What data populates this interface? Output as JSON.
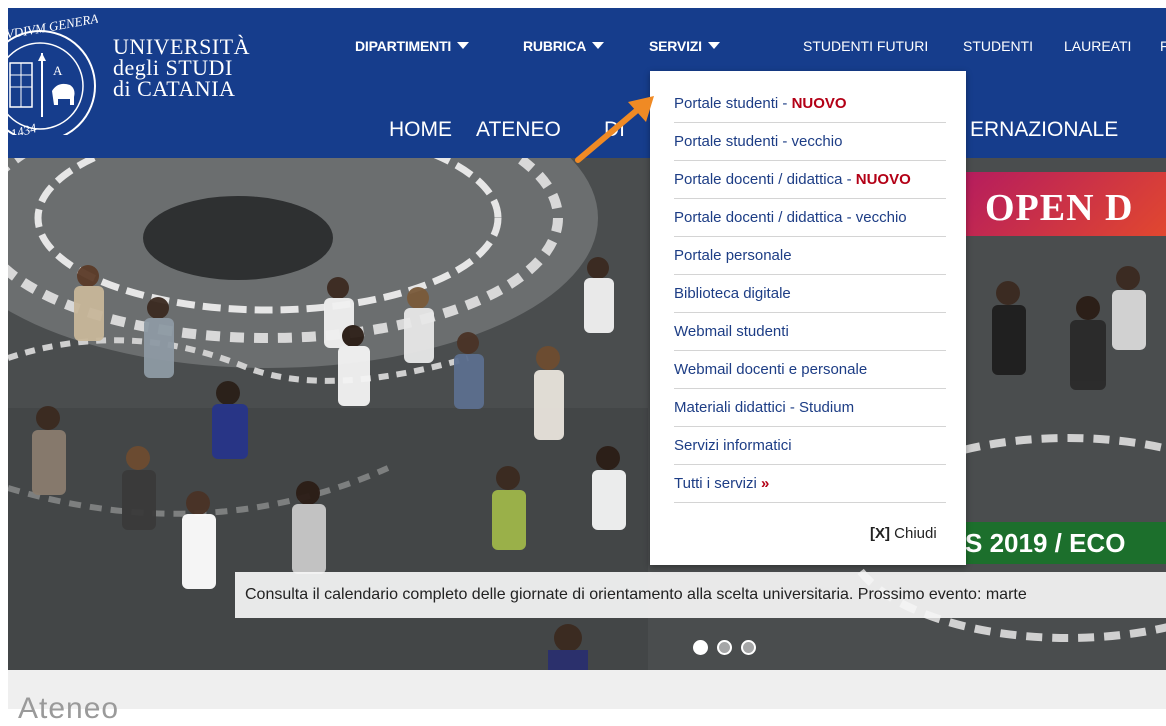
{
  "header": {
    "university_name": [
      "UNIVERSITÀ",
      "degli STUDI",
      "di CATANIA"
    ],
    "seal_text": [
      "VDIVM GENERALE",
      "1434"
    ],
    "top_nav": {
      "dipartimenti": "DIPARTIMENTI",
      "rubrica": "RUBRICA",
      "servizi": "SERVIZI",
      "studenti_futuri": "STUDENTI FUTURI",
      "studenti": "STUDENTI",
      "laureati": "LAUREATI",
      "cut_off": "F"
    },
    "main_nav": {
      "home": "HOME",
      "ateneo": "ATENEO",
      "partial_left": "DI",
      "internazionale": "ERNAZIONALE"
    }
  },
  "servizi_menu": {
    "items": [
      {
        "label": "Portale studenti - ",
        "badge": "NUOVO"
      },
      {
        "label": "Portale studenti - vecchio",
        "badge": ""
      },
      {
        "label": "Portale docenti / didattica - ",
        "badge": "NUOVO"
      },
      {
        "label": "Portale docenti / didattica - vecchio",
        "badge": ""
      },
      {
        "label": "Portale personale",
        "badge": ""
      },
      {
        "label": "Biblioteca digitale",
        "badge": ""
      },
      {
        "label": "Webmail studenti",
        "badge": ""
      },
      {
        "label": "Webmail docenti e personale",
        "badge": ""
      },
      {
        "label": "Materiali didattici - Studium",
        "badge": ""
      },
      {
        "label": "Servizi informatici",
        "badge": ""
      },
      {
        "label": "Tutti i servizi ",
        "badge": "»"
      }
    ],
    "close_bracket": "[X]",
    "close_label": " Chiudi"
  },
  "slider": {
    "banner_top": "OPEN D",
    "banner_bottom": "S 2019 / ECO",
    "caption": "Consulta il calendario completo delle giornate di orientamento alla scelta universitaria. Prossimo evento: marte",
    "active_dot": 0,
    "dot_count": 3
  },
  "section": {
    "title": "Ateneo"
  },
  "colors": {
    "header_blue": "#163d8c",
    "menu_link": "#1d3d85",
    "badge_red": "#b30016",
    "arrow_orange": "#f08a24",
    "banner_green": "#1c6f2c"
  }
}
